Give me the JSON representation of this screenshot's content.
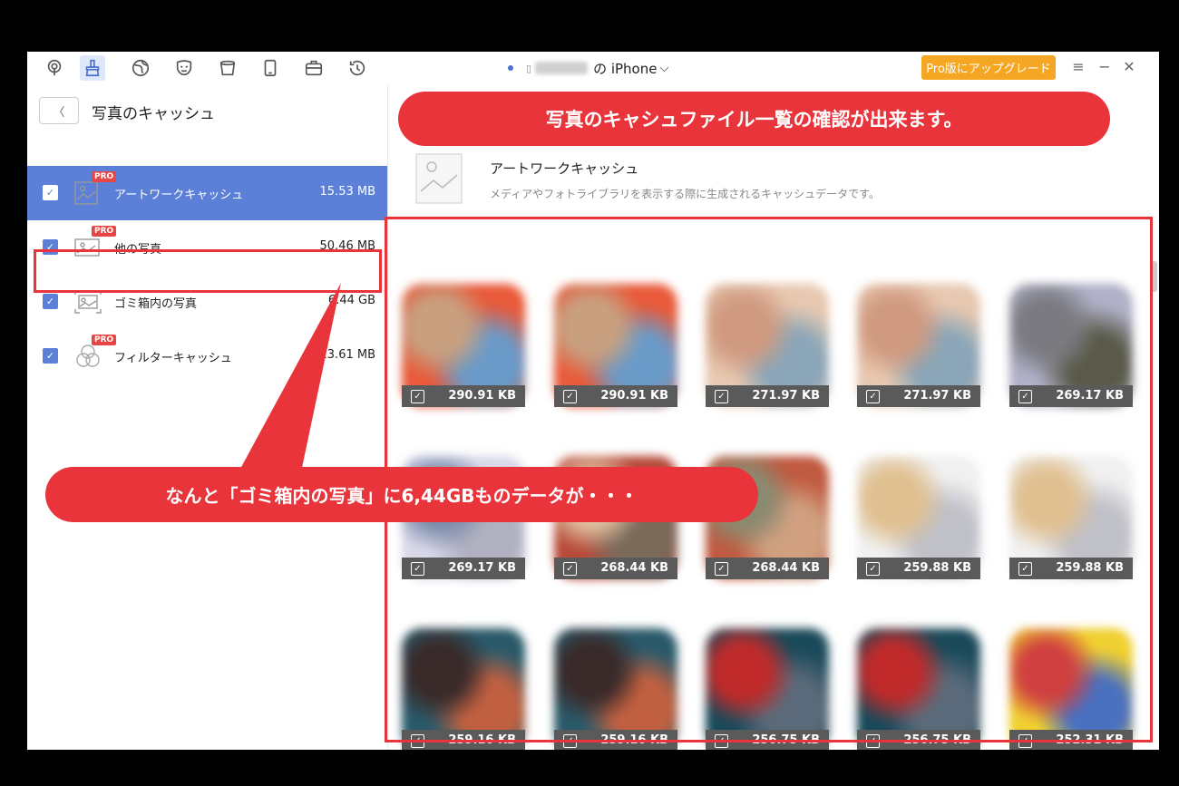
{
  "device": {
    "suffix": "の iPhone",
    "chevron": "⌵"
  },
  "upgrade_label": "Pro版にアップグレード",
  "window_controls": {
    "menu": "≡",
    "minimize": "−",
    "close": "✕"
  },
  "toolbar_icons": [
    "podcast-icon",
    "cleanup-icon",
    "globe-icon",
    "mask-icon",
    "trash-bin-icon",
    "phone-icon",
    "toolbox-icon",
    "clock-history-icon"
  ],
  "sidebar": {
    "back_symbol": "〈",
    "title": "写真のキャッシュ",
    "items": [
      {
        "label": "アートワークキャッシュ",
        "size": "15.53 MB",
        "pro": "PRO",
        "checked": true,
        "active": true
      },
      {
        "label": "他の写真",
        "size": "50.46 MB",
        "pro": "PRO",
        "checked": true,
        "active": false
      },
      {
        "label": "ゴミ箱内の写真",
        "size": "6.44 GB",
        "pro": "",
        "checked": true,
        "active": false
      },
      {
        "label": "フィルターキャッシュ",
        "size": "13.61 MB",
        "pro": "PRO",
        "checked": true,
        "active": false
      }
    ]
  },
  "main": {
    "category_title": "アートワークキャッシュ",
    "category_desc": "メディアやフォトライブラリを表示する際に生成されるキャッシュデータです。",
    "thumbnails": [
      {
        "size": "290.91 KB",
        "colors": [
          "#e85a3a",
          "#c8a080",
          "#6a9ac8"
        ]
      },
      {
        "size": "290.91 KB",
        "colors": [
          "#e85a3a",
          "#c8a080",
          "#6a9ac8"
        ]
      },
      {
        "size": "271.97 KB",
        "colors": [
          "#e8c8b0",
          "#d09a80",
          "#8aa6b8"
        ]
      },
      {
        "size": "271.97 KB",
        "colors": [
          "#e8c8b0",
          "#d09a80",
          "#8aa6b8"
        ]
      },
      {
        "size": "269.17 KB",
        "colors": [
          "#b0b0c8",
          "#7a7a80",
          "#5a5a4a"
        ]
      },
      {
        "size": "269.17 KB",
        "colors": [
          "#d8d8e8",
          "#7a8aaa",
          "#b0b0c0"
        ]
      },
      {
        "size": "268.44 KB",
        "colors": [
          "#b84a3a",
          "#e0c0a0",
          "#7a6a5a"
        ]
      },
      {
        "size": "268.44 KB",
        "colors": [
          "#c05a40",
          "#8a8a70",
          "#d0a080"
        ]
      },
      {
        "size": "259.88 KB",
        "colors": [
          "#f0f0f0",
          "#e0c090",
          "#c0c0c8"
        ]
      },
      {
        "size": "259.88 KB",
        "colors": [
          "#f0f0f0",
          "#e0c090",
          "#c0c0c8"
        ]
      },
      {
        "size": "259.16 KB",
        "colors": [
          "#2a5a6a",
          "#3a2a2a",
          "#c06040"
        ]
      },
      {
        "size": "259.16 KB",
        "colors": [
          "#2a5a6a",
          "#3a2a2a",
          "#c06040"
        ]
      },
      {
        "size": "256.75 KB",
        "colors": [
          "#1a4a5a",
          "#c02a2a",
          "#5a6a7a"
        ]
      },
      {
        "size": "256.75 KB",
        "colors": [
          "#1a4a5a",
          "#c02a2a",
          "#5a6a7a"
        ]
      },
      {
        "size": "252.31 KB",
        "colors": [
          "#f0d030",
          "#d04040",
          "#4a70c0"
        ]
      }
    ]
  },
  "annotations": {
    "top": "写真のキャシュファイル一覧の確認が出来ます。",
    "bottom": "なんと「ゴミ箱内の写真」に6,44GBものデータが・・・"
  },
  "colors": {
    "accent": "#5c7fd8",
    "annotation_red": "#e8343a",
    "upgrade": "#f5a623"
  }
}
